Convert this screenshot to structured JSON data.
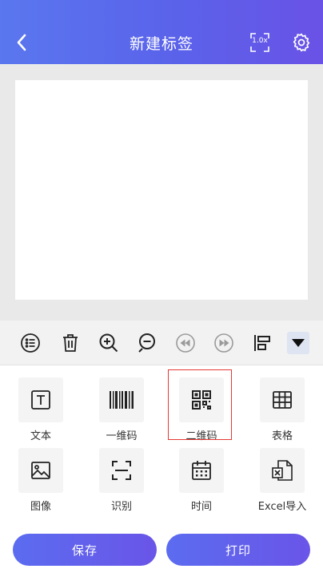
{
  "header": {
    "title": "新建标签",
    "zoom_label": "1.0x"
  },
  "tools": [
    {
      "label": "文本"
    },
    {
      "label": "一维码"
    },
    {
      "label": "二维码"
    },
    {
      "label": "表格"
    },
    {
      "label": "图像"
    },
    {
      "label": "识别"
    },
    {
      "label": "时间"
    },
    {
      "label": "Excel导入"
    }
  ],
  "buttons": {
    "save": "保存",
    "print": "打印"
  },
  "colors": {
    "accent": "#5a62ea",
    "highlight": "#e53935"
  }
}
